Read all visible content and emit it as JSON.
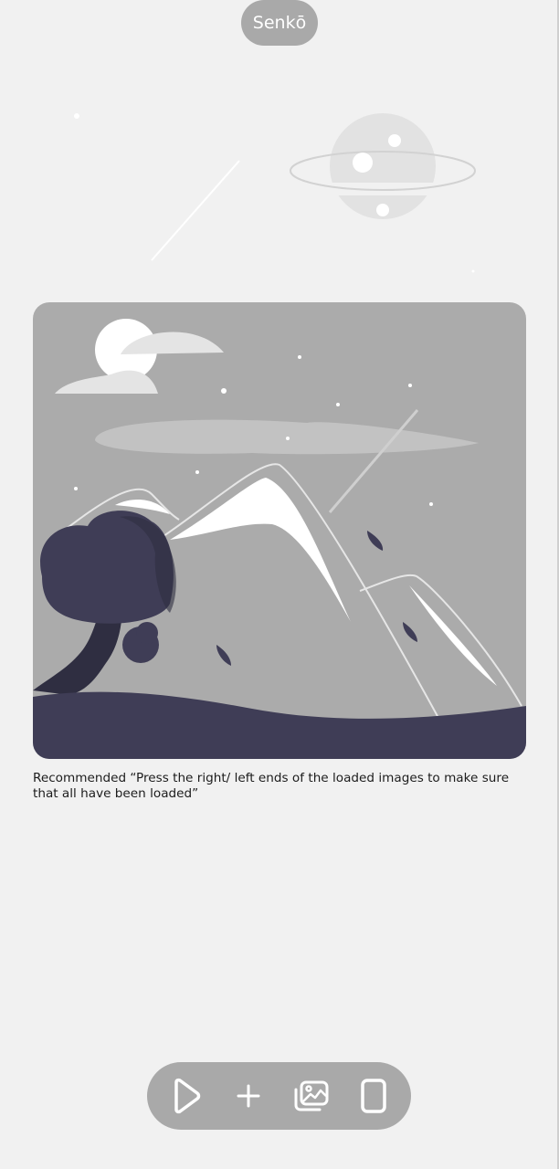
{
  "app": {
    "title": "Senkō"
  },
  "message": {
    "hint": "Recommended “Press the right/ left ends of the loaded images to make sure that all have been loaded”"
  },
  "bottom_bar": {
    "buttons": [
      {
        "name": "play",
        "icon": "play-icon"
      },
      {
        "name": "add",
        "icon": "plus-icon"
      },
      {
        "name": "gallery",
        "icon": "images-icon"
      },
      {
        "name": "single-page",
        "icon": "page-icon"
      }
    ]
  },
  "colors": {
    "background": "#f1f1f1",
    "pill": "#a9a9a9",
    "card": "#ababab",
    "ground": "#3f3d56",
    "icon": "#ffffff"
  }
}
